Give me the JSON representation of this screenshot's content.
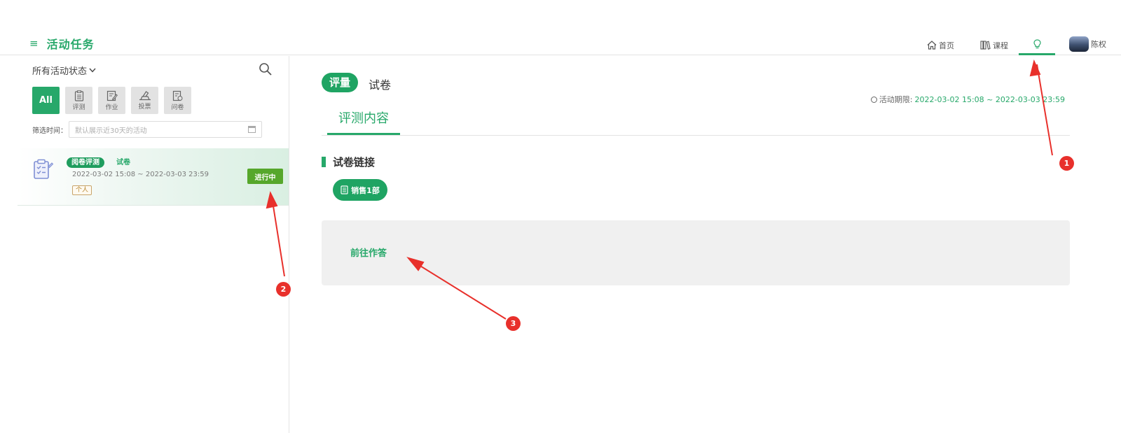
{
  "header": {
    "app_title": "活动任务",
    "nav": {
      "home_label": "首页",
      "course_label": "课程",
      "user_name": "陈权"
    }
  },
  "sidebar": {
    "status_filter_label": "所有活动状态",
    "type_tabs": [
      {
        "label": "All",
        "icon": "all"
      },
      {
        "label": "评测",
        "icon": "clipboard-icon"
      },
      {
        "label": "作业",
        "icon": "edit-doc-icon"
      },
      {
        "label": "投票",
        "icon": "vote-icon"
      },
      {
        "label": "问卷",
        "icon": "survey-icon"
      }
    ],
    "filter_time_label": "筛选时间：",
    "date_placeholder": "默认展示近30天的活动",
    "activity": {
      "type_badge": "阅卷评测",
      "kind": "试卷",
      "time_range": "2022-03-02 15:08 ~ 2022-03-03 23:59",
      "scope": "个人",
      "status": "进行中"
    }
  },
  "main": {
    "eval_tag": "评量",
    "paper_label": "试卷",
    "period_label": "活动期限:",
    "period_value": "2022-03-02 15:08 ~ 2022-03-03 23:59",
    "content_tab": "评测内容",
    "section_title": "试卷链接",
    "link_chip_label": "销售1部",
    "answer_link": "前往作答"
  },
  "annotations": {
    "markers": [
      "1",
      "2",
      "3"
    ],
    "color": "#e8302b"
  },
  "colors": {
    "brand_green": "#27a86a",
    "status_green": "#56a72b"
  }
}
